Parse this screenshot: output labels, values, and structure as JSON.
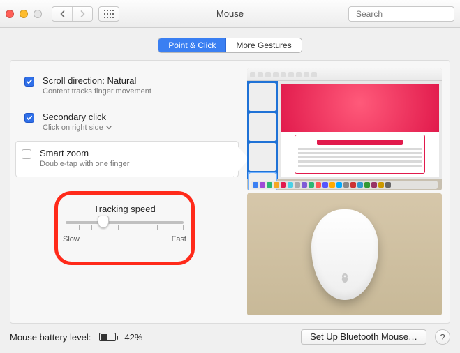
{
  "window": {
    "title": "Mouse",
    "search_placeholder": "Search"
  },
  "tabs": {
    "point_click": "Point & Click",
    "more_gestures": "More Gestures"
  },
  "options": {
    "scroll": {
      "title": "Scroll direction: Natural",
      "sub": "Content tracks finger movement",
      "checked": true
    },
    "secondary": {
      "title": "Secondary click",
      "sub": "Click on right side",
      "checked": true,
      "has_menu": true
    },
    "smartzoom": {
      "title": "Smart zoom",
      "sub": "Double-tap with one finger",
      "checked": false,
      "selected": true
    }
  },
  "tracking": {
    "title": "Tracking speed",
    "slow": "Slow",
    "fast": "Fast"
  },
  "battery": {
    "label": "Mouse battery level:",
    "percent": "42%"
  },
  "buttons": {
    "setup_bluetooth": "Set Up Bluetooth Mouse…"
  },
  "help": "?",
  "colors": {
    "accent": "#3a7ff2",
    "highlight_ring": "#ff2a1a"
  }
}
